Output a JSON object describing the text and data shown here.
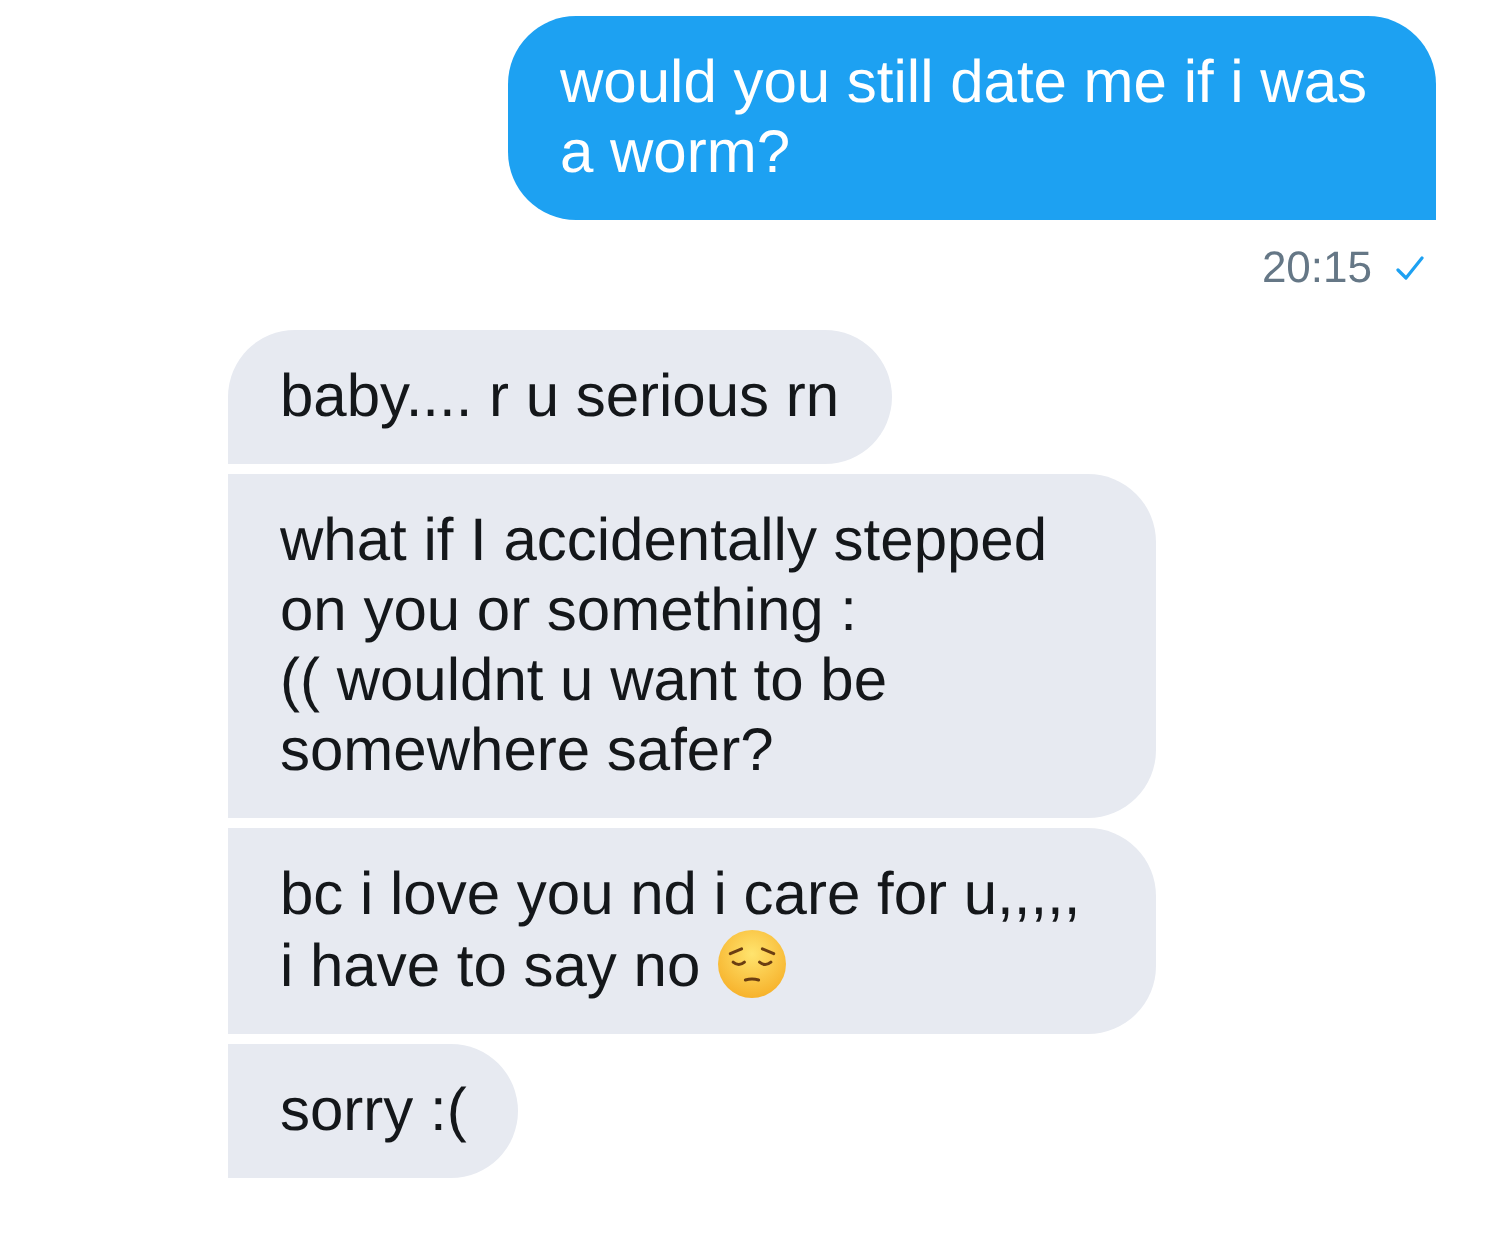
{
  "messages": [
    {
      "kind": "sent",
      "text": "would you still date me if i was a worm?",
      "time": "20:15",
      "delivered": true
    },
    {
      "kind": "received",
      "text": "baby.... r u serious rn"
    },
    {
      "kind": "received",
      "text": "what if I accidentally stepped on you or something :\n(( wouldnt u want to be somewhere safer?"
    },
    {
      "kind": "received",
      "text": "bc i love you nd i care for u,,,,, i have to say no",
      "has_emoji": true
    },
    {
      "kind": "received",
      "text": "sorry :("
    }
  ]
}
